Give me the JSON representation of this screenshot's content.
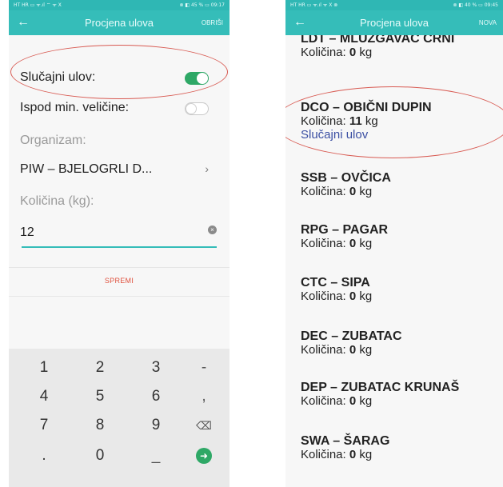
{
  "left_screen": {
    "status": {
      "left": "HT HR ▭ ᯤ.ıl ⌔ ᯤ X",
      "right": "⊗ ◧ 45 % ▭ 09:17"
    },
    "appbar": {
      "back_icon": "arrow-left-icon",
      "title": "Procjena ulova",
      "action": "OBRIŠI"
    },
    "form": {
      "random_catch_label": "Slučajni ulov:",
      "random_catch_on": true,
      "below_min_label": "Ispod min. veličine:",
      "below_min_on": false,
      "organism_label": "Organizam:",
      "organism_value": "PIW – BJELOGRLI D...",
      "quantity_label": "Količina (kg):",
      "quantity_value": "12",
      "save_label": "SPREMI"
    },
    "keypad": {
      "row1": [
        "1",
        "2",
        "3",
        "-"
      ],
      "row2": [
        "4",
        "5",
        "6",
        ","
      ],
      "row3": [
        "7",
        "8",
        "9",
        "⌫"
      ],
      "row4": [
        ".",
        "0",
        "_",
        "➜"
      ]
    }
  },
  "right_screen": {
    "status": {
      "left": "HT HR ▭ ᯤ.ıl ᯤ X ⊗",
      "right": "⊗ ◧ 40 % ▭ 09:45"
    },
    "appbar": {
      "back_icon": "arrow-left-icon",
      "title": "Procjena ulova",
      "action": "NOVA"
    },
    "partial_top": {
      "code": "LDT – MLUZGAVAC CRNI",
      "qty_label": "Količina:",
      "qty_value": "0",
      "unit": "kg"
    },
    "items": [
      {
        "code": "DCO – OBIČNI DUPIN",
        "qty_label": "Količina:",
        "qty_value": "11",
        "unit": "kg",
        "tag": "Slučajni ulov"
      },
      {
        "code": "SSB – OVČICA",
        "qty_label": "Količina:",
        "qty_value": "0",
        "unit": "kg"
      },
      {
        "code": "RPG – PAGAR",
        "qty_label": "Količina:",
        "qty_value": "0",
        "unit": "kg"
      },
      {
        "code": "CTC – SIPA",
        "qty_label": "Količina:",
        "qty_value": "0",
        "unit": "kg"
      },
      {
        "code": "DEC – ZUBATAC",
        "qty_label": "Količina:",
        "qty_value": "0",
        "unit": "kg"
      },
      {
        "code": "DEP – ZUBATAC KRUNAŠ",
        "qty_label": "Količina:",
        "qty_value": "0",
        "unit": "kg"
      },
      {
        "code": "SWA – ŠARAG",
        "qty_label": "Količina:",
        "qty_value": "0",
        "unit": "kg"
      }
    ]
  },
  "colors": {
    "accent": "#35bdb9",
    "toggle_on": "#2ea866",
    "save": "#e0523f",
    "tag": "#3b4fa3",
    "highlight": "#d85a52"
  }
}
